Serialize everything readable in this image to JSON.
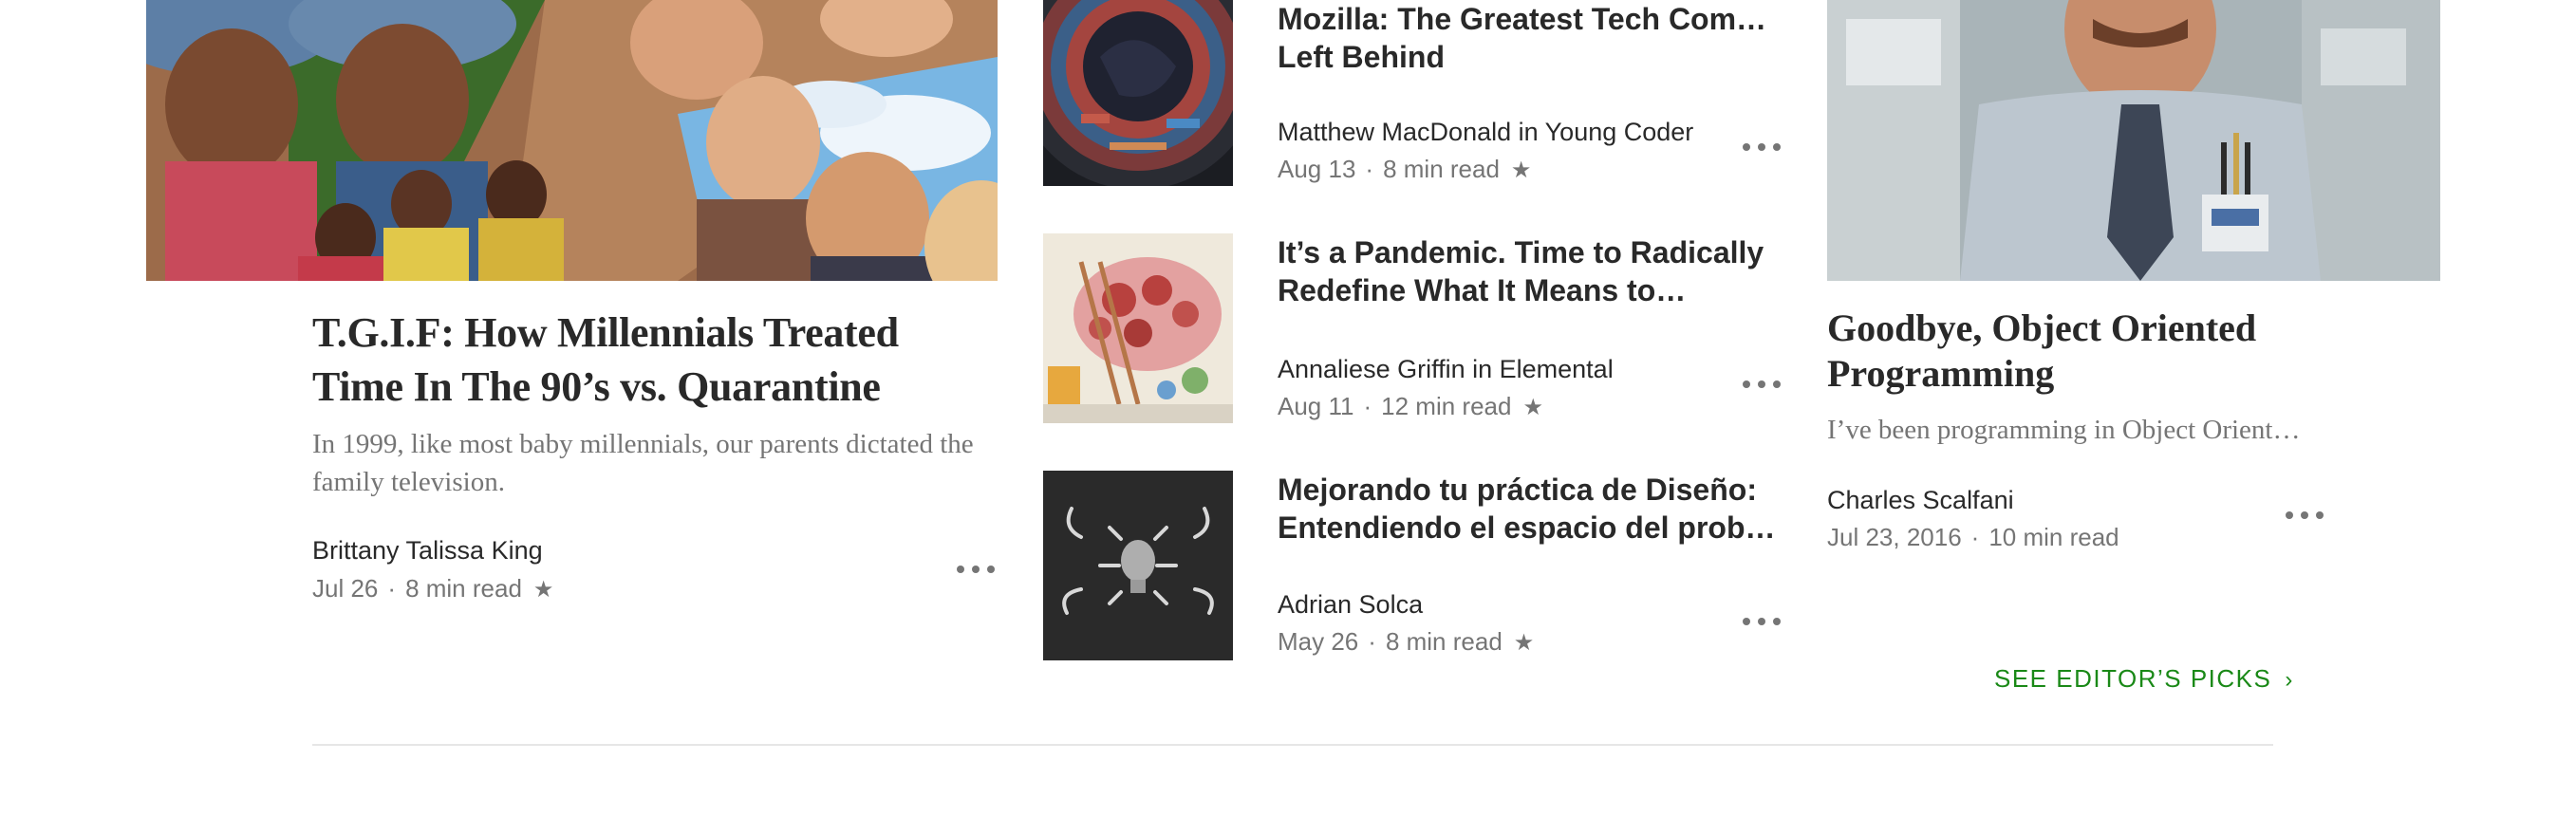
{
  "left_card": {
    "title": "T.G.I.F: How Millennials Treated Time In The 90’s vs. Quarantine",
    "subtitle": "In 1999, like most baby millennials, our parents dictated the family television.",
    "author": "Brittany Talissa King",
    "date": "Jul 26",
    "read_time": "8 min read",
    "star": "★",
    "separator": "·"
  },
  "middle_list": [
    {
      "title_line1": "Mozilla: The Greatest Tech Company",
      "title_line2": "Left Behind",
      "author": "Matthew MacDonald in Young Coder",
      "date": "Aug 13",
      "read_time": "8 min read",
      "star": "★",
      "separator": "·"
    },
    {
      "title_line1": "It’s a Pandemic. Time to Radically",
      "title_line2": "Redefine What It Means to…",
      "author": "Annaliese Griffin in Elemental",
      "date": "Aug 11",
      "read_time": "12 min read",
      "star": "★",
      "separator": "·"
    },
    {
      "title_line1": "Mejorando tu práctica de Diseño:",
      "title_line2": "Entendiendo el espacio del proble…",
      "author": "Adrian Solca",
      "date": "May 26",
      "read_time": "8 min read",
      "star": "★",
      "separator": "·"
    }
  ],
  "right_card": {
    "title": "Goodbye, Object Oriented Programming",
    "subtitle": "I’ve been programming in Object Orient…",
    "author": "Charles Scalfani",
    "date": "Jul 23, 2016",
    "read_time": "10 min read",
    "separator": "·"
  },
  "editors_picks": {
    "label": "SEE EDITOR’S PICKS",
    "chevron": "›"
  },
  "colors": {
    "accent_green": "#1a8917",
    "text_dark": "#292929",
    "text_muted": "#757575"
  }
}
